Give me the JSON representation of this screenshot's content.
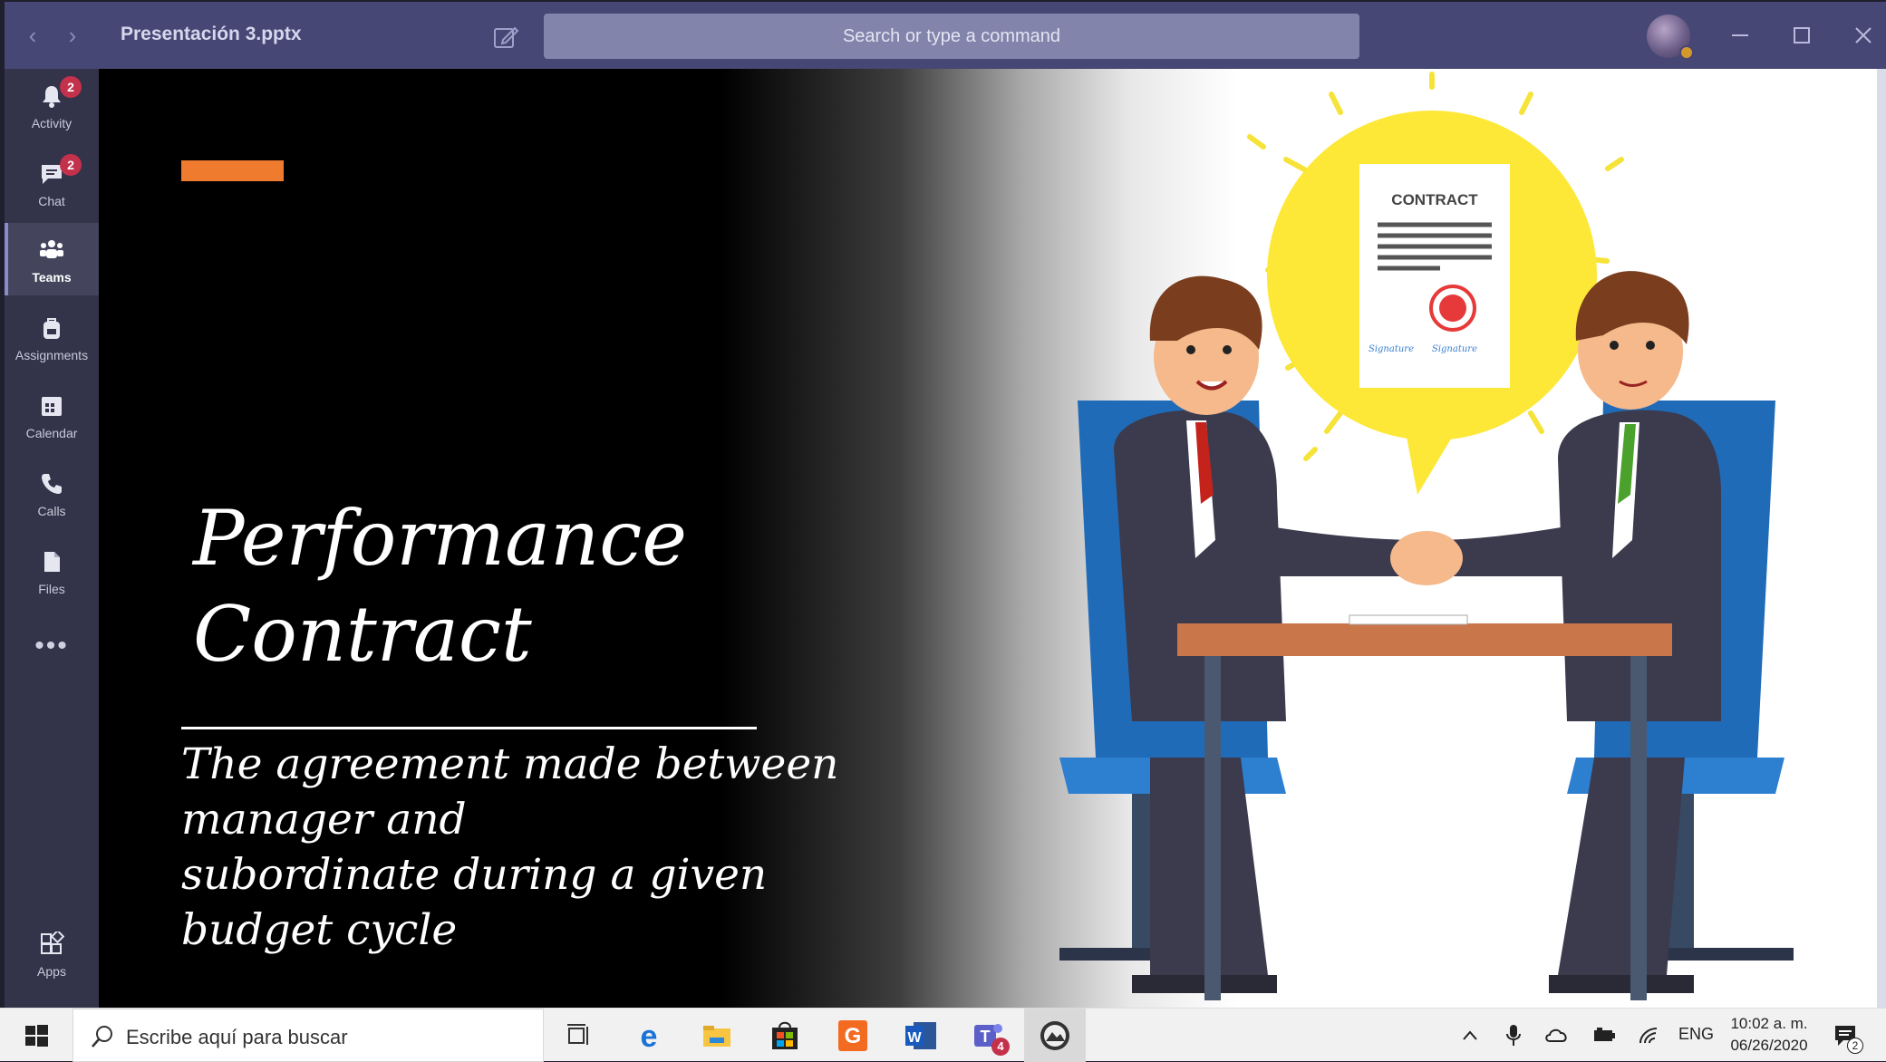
{
  "window": {
    "title": "Presentación 3.pptx",
    "search_placeholder": "Search or type a command"
  },
  "rail": {
    "items": [
      {
        "label": "Activity",
        "badge": "2"
      },
      {
        "label": "Chat",
        "badge": "2"
      },
      {
        "label": "Teams"
      },
      {
        "label": "Assignments"
      },
      {
        "label": "Calendar"
      },
      {
        "label": "Calls"
      },
      {
        "label": "Files"
      },
      {
        "label": "Apps"
      }
    ],
    "more": "•••"
  },
  "slide": {
    "title_line1": "Performance",
    "title_line2": "Contract",
    "subtitle": "The agreement made between\nmanager  and\nsubordinate  during a given\nbudget cycle",
    "illustration": {
      "document_heading": "CONTRACT",
      "signature_left": "Signature",
      "signature_right": "Signature"
    },
    "accent_color": "#ef7b2f"
  },
  "taskbar": {
    "search_placeholder": "Escribe aquí para buscar",
    "teams_badge": "4",
    "language": "ENG",
    "time": "10:02 a. m.",
    "date": "06/26/2020",
    "notification_count": "2"
  },
  "colors": {
    "titlebar": "#464775",
    "rail": "#33344a",
    "badge": "#c4314b"
  }
}
